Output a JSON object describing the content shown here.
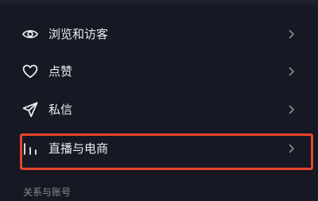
{
  "settings": {
    "items": [
      {
        "id": "browse",
        "label": "浏览和访客",
        "icon": "eye-icon"
      },
      {
        "id": "likes",
        "label": "点赞",
        "icon": "heart-icon"
      },
      {
        "id": "messages",
        "label": "私信",
        "icon": "paper-plane-icon"
      },
      {
        "id": "live",
        "label": "直播与电商",
        "icon": "bar-chart-icon"
      }
    ],
    "next_section_title": "关系与账号"
  },
  "colors": {
    "background": "#161823",
    "text": "#ebebee",
    "muted_text": "#8a8b93",
    "chevron": "#8a8b93",
    "highlight": "#e8442b"
  }
}
